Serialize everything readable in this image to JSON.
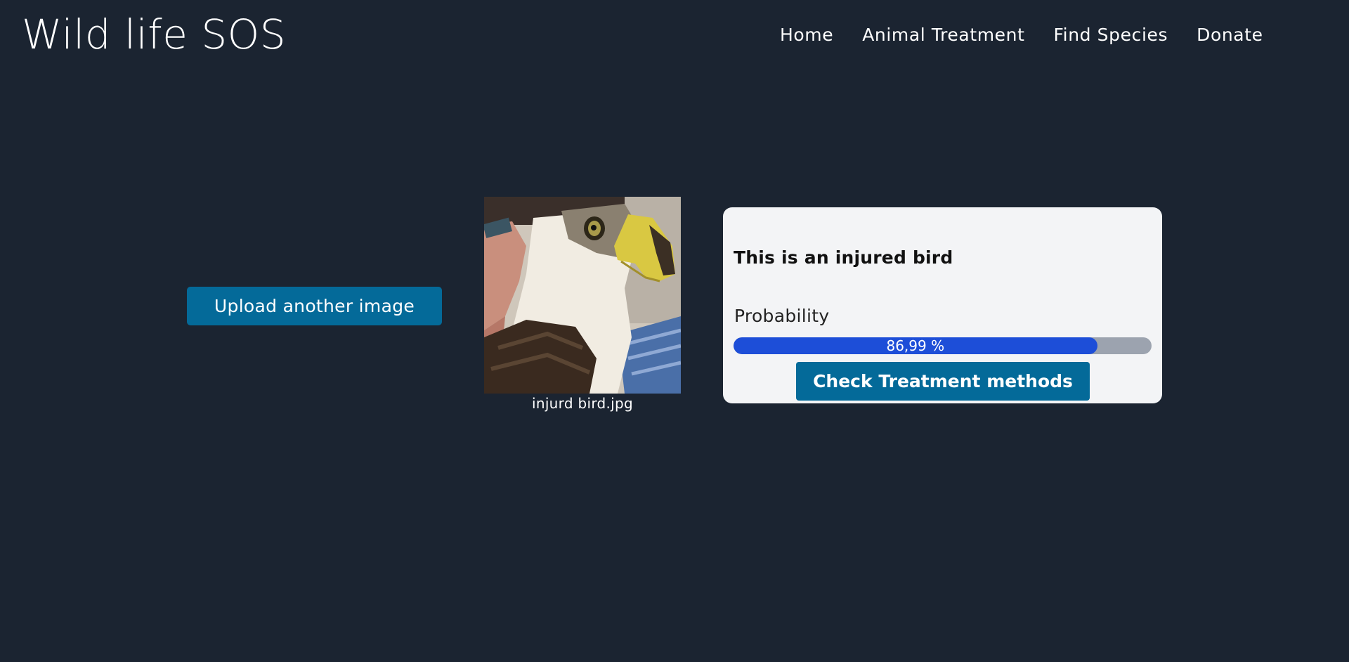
{
  "header": {
    "site_title": "Wild life SOS",
    "nav": [
      {
        "label": "Home"
      },
      {
        "label": "Animal Treatment"
      },
      {
        "label": "Find Species"
      },
      {
        "label": "Donate"
      }
    ]
  },
  "upload": {
    "button_label": "Upload another image"
  },
  "preview": {
    "file_name": "injurd bird.jpg"
  },
  "result": {
    "prediction": "This is an injured bird",
    "probability_label": "Probability",
    "probability_text": "86,99 %",
    "probability_value": 86.99,
    "treatment_button_label": "Check Treatment methods"
  },
  "colors": {
    "background": "#1b2431",
    "button": "#046a99",
    "card": "#f3f4f6",
    "progress_fill": "#1d4ed8",
    "progress_track": "#9ca3af"
  }
}
